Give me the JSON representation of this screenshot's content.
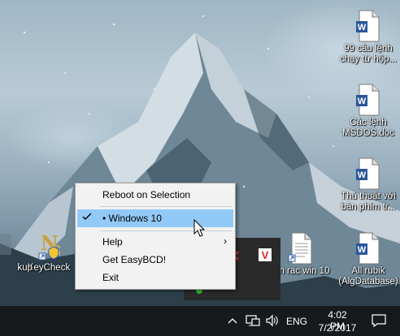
{
  "desktop": {
    "icons": [
      {
        "label": "99 câu lệnh chạy từ hộp...",
        "icon": "word-document-icon"
      },
      {
        "label": "Các lệnh MSDOS.doc",
        "icon": "word-document-icon"
      },
      {
        "label": "Thủ thuật với bàn phím tr...",
        "icon": "word-document-icon"
      },
      {
        "label": "All rubik (AlgDatabase)",
        "icon": "word-document-icon"
      },
      {
        "label": "lon rac win 10",
        "icon": "text-document-icon"
      },
      {
        "label": "KeyCheck",
        "icon": "keycheck-shortcut-icon"
      },
      {
        "label": "kup",
        "icon": "shortcut-icon"
      }
    ]
  },
  "context_menu": {
    "items": [
      {
        "label": "Reboot on Selection"
      },
      {
        "label": "• Windows 10",
        "checked": true
      },
      {
        "label": "Help",
        "submenu": true
      },
      {
        "label": "Get EasyBCD!"
      },
      {
        "label": "Exit"
      }
    ]
  },
  "tray_popup": {
    "icons": [
      "red-x-icon",
      "vivaldi-v-icon",
      "green-dot-icon"
    ]
  },
  "taskbar": {
    "tray_icons": [
      "chevron-up-icon",
      "network-icon",
      "volume-icon"
    ],
    "language": "ENG",
    "time": "4:02 PM",
    "date": "7/2/2017",
    "notification_icon": "action-center-icon"
  },
  "colors": {
    "menu_highlight": "#91c9f7",
    "menu_background": "#f2f2f2",
    "taskbar": "#161a1d"
  }
}
